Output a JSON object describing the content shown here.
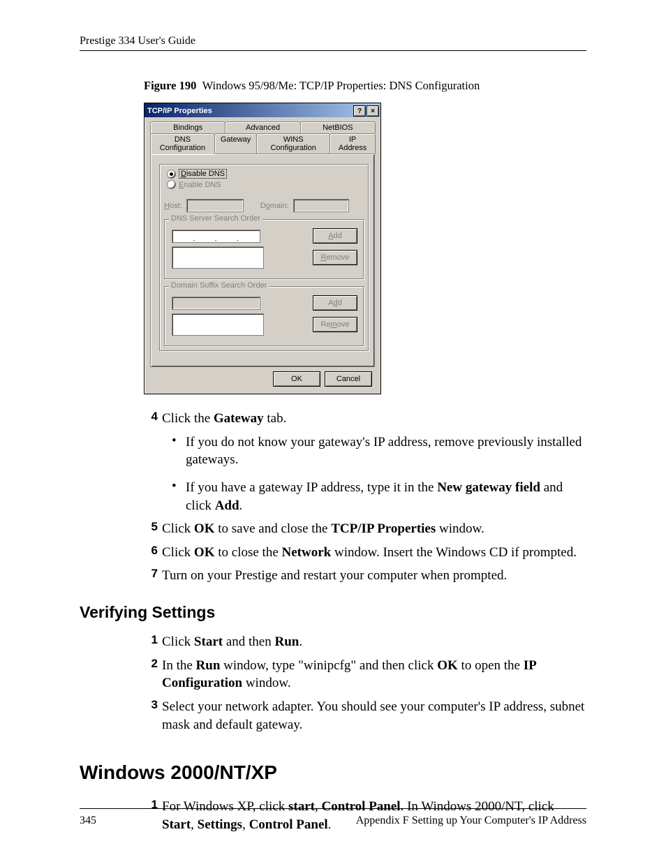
{
  "header": {
    "title": "Prestige 334 User's Guide"
  },
  "figure": {
    "label": "Figure 190",
    "caption": "Windows 95/98/Me: TCP/IP Properties: DNS Configuration"
  },
  "dialog": {
    "title": "TCP/IP Properties",
    "help_btn": "?",
    "close_btn": "×",
    "tabs_row1": [
      "Bindings",
      "Advanced",
      "NetBIOS"
    ],
    "tabs_row2": [
      "DNS Configuration",
      "Gateway",
      "WINS Configuration",
      "IP Address"
    ],
    "active_tab": "DNS Configuration",
    "radio_disable": "Disable DNS",
    "radio_enable": "Enable DNS",
    "host_label": "Host:",
    "domain_label": "Domain:",
    "dns_group": "DNS Server Search Order",
    "suffix_group": "Domain Suffix Search Order",
    "btn_add": "Add",
    "btn_remove": "Remove",
    "btn_ok": "OK",
    "btn_cancel": "Cancel"
  },
  "steps_a": {
    "4": {
      "pre": "Click the ",
      "bold": "Gateway",
      "post": " tab."
    },
    "bullets": [
      {
        "text": "If you do not know your gateway's IP address, remove previously installed gateways."
      },
      {
        "pre": "If you have a gateway IP address, type it in the ",
        "b1": "New gateway field",
        "mid": " and click ",
        "b2": "Add",
        "post": "."
      }
    ],
    "5": {
      "pre": "Click ",
      "b1": "OK",
      "mid": " to save and close the ",
      "b2": "TCP/IP Properties",
      "post": " window."
    },
    "6": {
      "pre": "Click ",
      "b1": "OK",
      "mid": " to close the ",
      "b2": "Network",
      "post": " window. Insert the Windows CD if prompted."
    },
    "7": {
      "text": "Turn on your Prestige and restart your computer when prompted."
    }
  },
  "section_verify": {
    "heading": "Verifying Settings",
    "1": {
      "pre": "Click ",
      "b1": "Start",
      "mid": " and then ",
      "b2": "Run",
      "post": "."
    },
    "2": {
      "pre": "In the ",
      "b1": "Run",
      "mid1": " window, type \"winipcfg\" and then click ",
      "b2": "OK",
      "mid2": " to open the ",
      "b3": "IP Configuration",
      "post": " window."
    },
    "3": {
      "text": "Select your network adapter. You should see your computer's IP address, subnet mask and default gateway."
    }
  },
  "section_win2k": {
    "heading": "Windows 2000/NT/XP",
    "1": {
      "pre": "For Windows XP, click ",
      "b1": "start",
      "mid1": ", ",
      "b2": "Control Panel",
      "mid2": ". In Windows 2000/NT, click ",
      "b3": "Start",
      "mid3": ", ",
      "b4": "Settings",
      "mid4": ", ",
      "b5": "Control Panel",
      "post": "."
    }
  },
  "footer": {
    "page": "345",
    "text": "Appendix F Setting up Your Computer's IP Address"
  }
}
